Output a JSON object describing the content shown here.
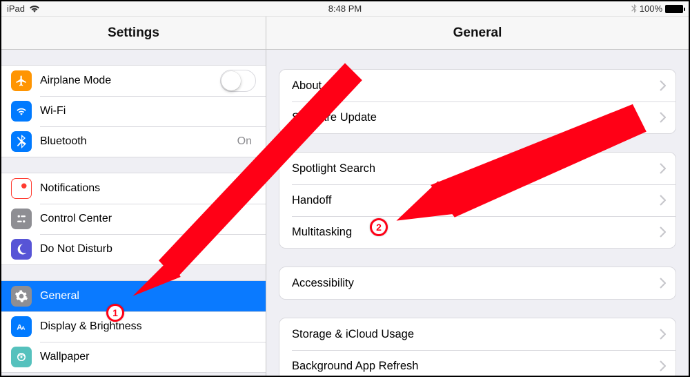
{
  "status": {
    "device": "iPad",
    "time": "8:48 PM",
    "battery_pct": "100%"
  },
  "header": {
    "left_title": "Settings",
    "right_title": "General"
  },
  "settings_groups": [
    {
      "rows": [
        {
          "id": "airplane",
          "label": "Airplane Mode",
          "icon": "airplane-icon",
          "color": "bg-orange",
          "control": "toggle_off"
        },
        {
          "id": "wifi",
          "label": "Wi-Fi",
          "icon": "wifi-icon",
          "color": "bg-blue",
          "value": ""
        },
        {
          "id": "bluetooth",
          "label": "Bluetooth",
          "icon": "bluetooth-icon",
          "color": "bg-blue",
          "value": "On"
        }
      ]
    },
    {
      "rows": [
        {
          "id": "notifications",
          "label": "Notifications",
          "icon": "notifications-icon",
          "color": "bg-red-notif"
        },
        {
          "id": "controlcenter",
          "label": "Control Center",
          "icon": "control-center-icon",
          "color": "bg-gray"
        },
        {
          "id": "dnd",
          "label": "Do Not Disturb",
          "icon": "moon-icon",
          "color": "bg-purple"
        }
      ]
    },
    {
      "rows": [
        {
          "id": "general",
          "label": "General",
          "icon": "gear-icon",
          "color": "bg-gray",
          "selected": true
        },
        {
          "id": "display",
          "label": "Display & Brightness",
          "icon": "display-icon",
          "color": "bg-blue"
        },
        {
          "id": "wallpaper",
          "label": "Wallpaper",
          "icon": "wallpaper-icon",
          "color": "bg-teal"
        }
      ]
    }
  ],
  "general_groups": [
    {
      "rows": [
        {
          "id": "about",
          "label": "About"
        },
        {
          "id": "swupdate",
          "label": "Software Update"
        }
      ]
    },
    {
      "rows": [
        {
          "id": "spotlight",
          "label": "Spotlight Search"
        },
        {
          "id": "handoff",
          "label": "Handoff"
        },
        {
          "id": "multitask",
          "label": "Multitasking"
        }
      ]
    },
    {
      "rows": [
        {
          "id": "accessibility",
          "label": "Accessibility"
        }
      ]
    },
    {
      "rows": [
        {
          "id": "storage",
          "label": "Storage & iCloud Usage"
        },
        {
          "id": "bgapp",
          "label": "Background App Refresh"
        }
      ]
    }
  ],
  "annotations": {
    "badge1": "1",
    "badge2": "2",
    "arrow_color": "#ff0016"
  }
}
